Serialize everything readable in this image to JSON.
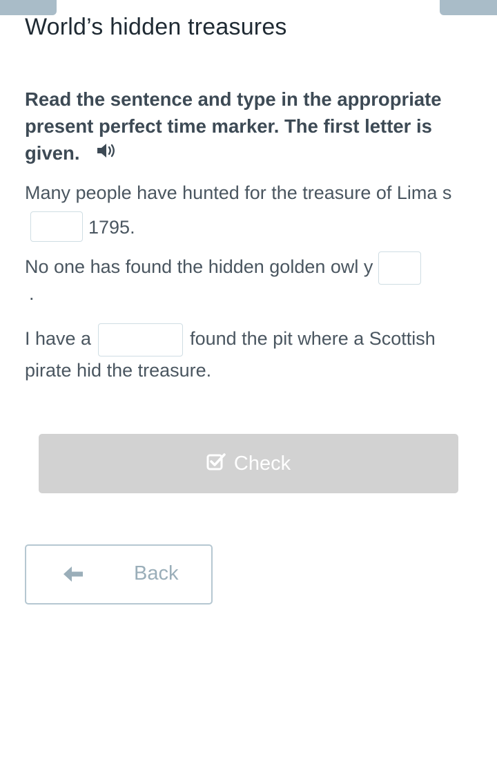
{
  "page": {
    "title": "World’s hidden treasures"
  },
  "task": {
    "instruction": "Read the sentence and type in the appropriate present perfect time marker. The first letter is given.",
    "audio_icon": "speaker-icon"
  },
  "sentences": [
    {
      "before": "Many people have hunted for the treasure of Lima s",
      "blank_value": "",
      "after": "1795."
    },
    {
      "before": "No one has found the hidden golden owl y",
      "blank_value": "",
      "after": "."
    },
    {
      "before": "I have a",
      "blank_value": "",
      "after": "found the pit where a Scottish pirate hid the treasure."
    }
  ],
  "actions": {
    "check_label": "Check",
    "check_icon": "checkbox-check-icon",
    "back_label": "Back",
    "back_icon": "arrow-left-icon"
  },
  "colors": {
    "tab": "#a9bcc8",
    "check_button_disabled": "#d2d2d2",
    "back_border": "#b5c7d1",
    "text": "#3d4a55"
  }
}
